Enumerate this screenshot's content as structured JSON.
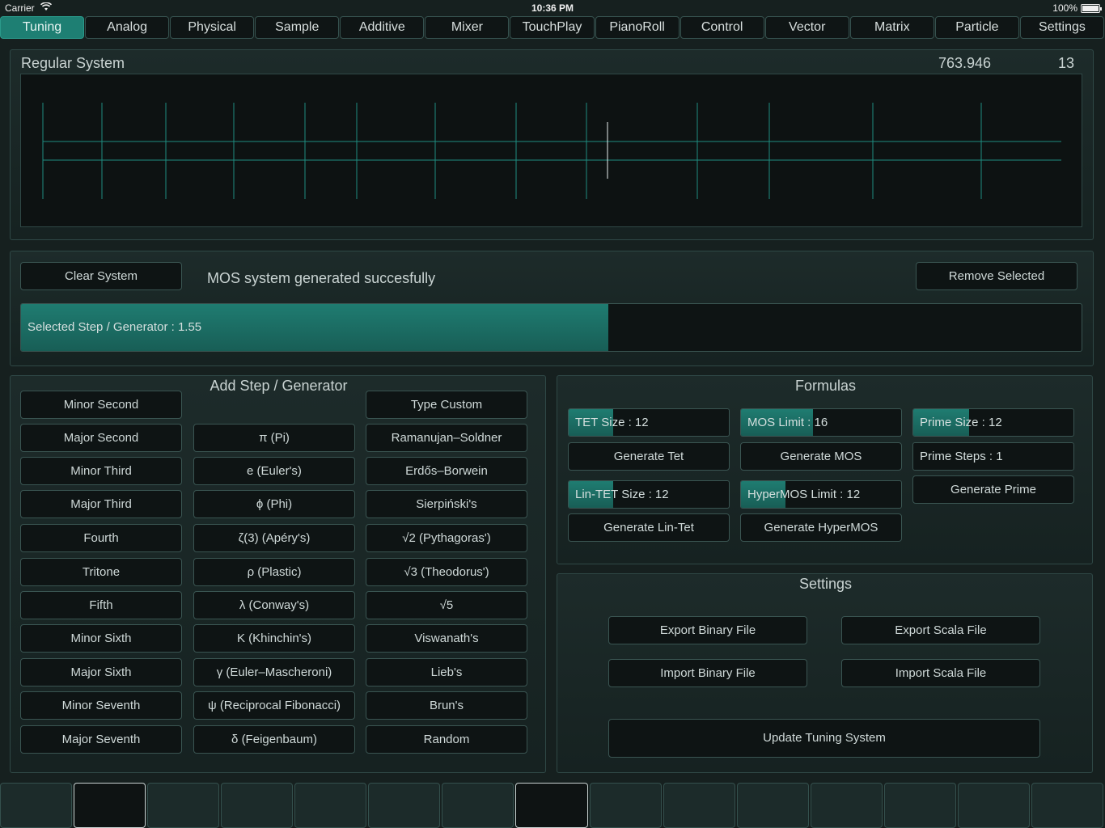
{
  "status_bar": {
    "carrier": "Carrier",
    "time": "10:36 PM",
    "battery": "100%"
  },
  "tabs": [
    "Tuning",
    "Analog",
    "Physical",
    "Sample",
    "Additive",
    "Mixer",
    "TouchPlay",
    "PianoRoll",
    "Control",
    "Vector",
    "Matrix",
    "Particle",
    "Settings"
  ],
  "active_tab": "Tuning",
  "regular_system": {
    "title": "Regular System",
    "value": "763.946",
    "count": "13"
  },
  "system_controls": {
    "clear_label": "Clear System",
    "message": "MOS system generated succesfully",
    "remove_label": "Remove Selected",
    "selected_step_label": "Selected Step / Generator : 1.55",
    "selected_step_fraction": 0.554
  },
  "add_step": {
    "title": "Add Step / Generator",
    "col1": [
      "Minor Second",
      "Major Second",
      "Minor Third",
      "Major Third",
      "Fourth",
      "Tritone",
      "Fifth",
      "Minor Sixth",
      "Major Sixth",
      "Minor Seventh",
      "Major Seventh"
    ],
    "col2": [
      "π (Pi)",
      "e (Euler's)",
      "ϕ (Phi)",
      "ζ(3) (Apéry's)",
      "ρ (Plastic)",
      "λ (Conway's)",
      "Κ (Khinchin's)",
      "γ (Euler–Mascheroni)",
      "ψ (Reciprocal Fibonacci)",
      "δ (Feigenbaum)"
    ],
    "col3": [
      "Type Custom",
      "Ramanujan–Soldner",
      "Erdős–Borwein",
      "Sierpiński's",
      "√2 (Pythagoras')",
      "√3 (Theodorus')",
      "√5",
      "Viswanath's",
      "Lieb's",
      "Brun's",
      "Random"
    ]
  },
  "formulas": {
    "title": "Formulas",
    "tet_size": {
      "label": "TET Size : 12",
      "fraction": 0.28
    },
    "mos_limit": {
      "label": "MOS Limit : 16",
      "fraction": 0.45
    },
    "prime_size": {
      "label": "Prime Size : 12",
      "fraction": 0.35
    },
    "prime_steps": {
      "label": "Prime Steps : 1",
      "fraction": 0.0
    },
    "lin_tet_size": {
      "label": "Lin-TET Size : 12",
      "fraction": 0.28
    },
    "hypermos_limit": {
      "label": "HyperMOS Limit : 12",
      "fraction": 0.28
    },
    "generate_tet": "Generate Tet",
    "generate_mos": "Generate MOS",
    "generate_prime": "Generate Prime",
    "generate_lin_tet": "Generate Lin-Tet",
    "generate_hypermos": "Generate HyperMOS"
  },
  "settings": {
    "title": "Settings",
    "export_binary": "Export Binary File",
    "export_scala": "Export Scala File",
    "import_binary": "Import Binary File",
    "import_scala": "Import Scala File",
    "update": "Update Tuning System"
  },
  "keyboard_key_count": 15
}
